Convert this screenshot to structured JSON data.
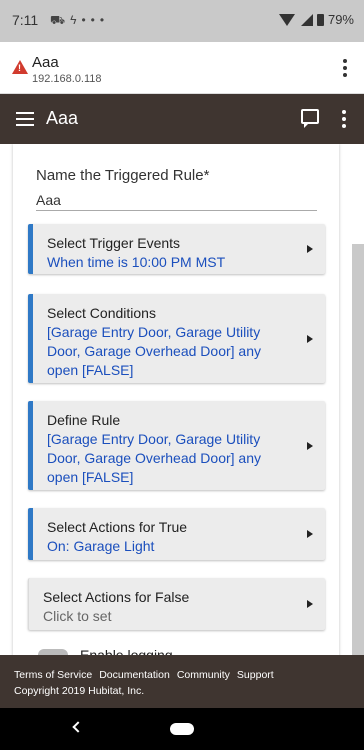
{
  "status": {
    "time": "7:11",
    "notification_icons": [
      "car-icon",
      "bolt-icon",
      "more-dots-icon"
    ],
    "battery": "79%"
  },
  "browser": {
    "title": "Aaa",
    "url": "192.168.0.118"
  },
  "header": {
    "title": "Aaa"
  },
  "form": {
    "name_label": "Name the Triggered Rule*",
    "name_value": "Aaa"
  },
  "cards": [
    {
      "title": "Select Trigger Events",
      "value": "When time is 10:00 PM MST",
      "set": true
    },
    {
      "title": "Select Conditions",
      "value": "[Garage Entry Door, Garage Utility Door, Garage Overhead Door] any open [FALSE]",
      "set": true
    },
    {
      "title": "Define Rule",
      "value": "[Garage Entry Door, Garage Utility Door, Garage Overhead Door] any open [FALSE]",
      "set": true
    },
    {
      "title": "Select Actions for True",
      "value": "On: Garage Light",
      "set": true
    },
    {
      "title": "Select Actions for False",
      "value": "Click to set",
      "set": false
    }
  ],
  "partial": {
    "toggle_label": "Enable logging"
  },
  "footer": {
    "links": [
      "Terms of Service",
      "Documentation",
      "Community",
      "Support"
    ],
    "copyright": "Copyright 2019 Hubitat, Inc."
  },
  "colors": {
    "header_bg": "#3f3530",
    "accent": "#2f79c6",
    "link_text": "#1b4fbd"
  }
}
